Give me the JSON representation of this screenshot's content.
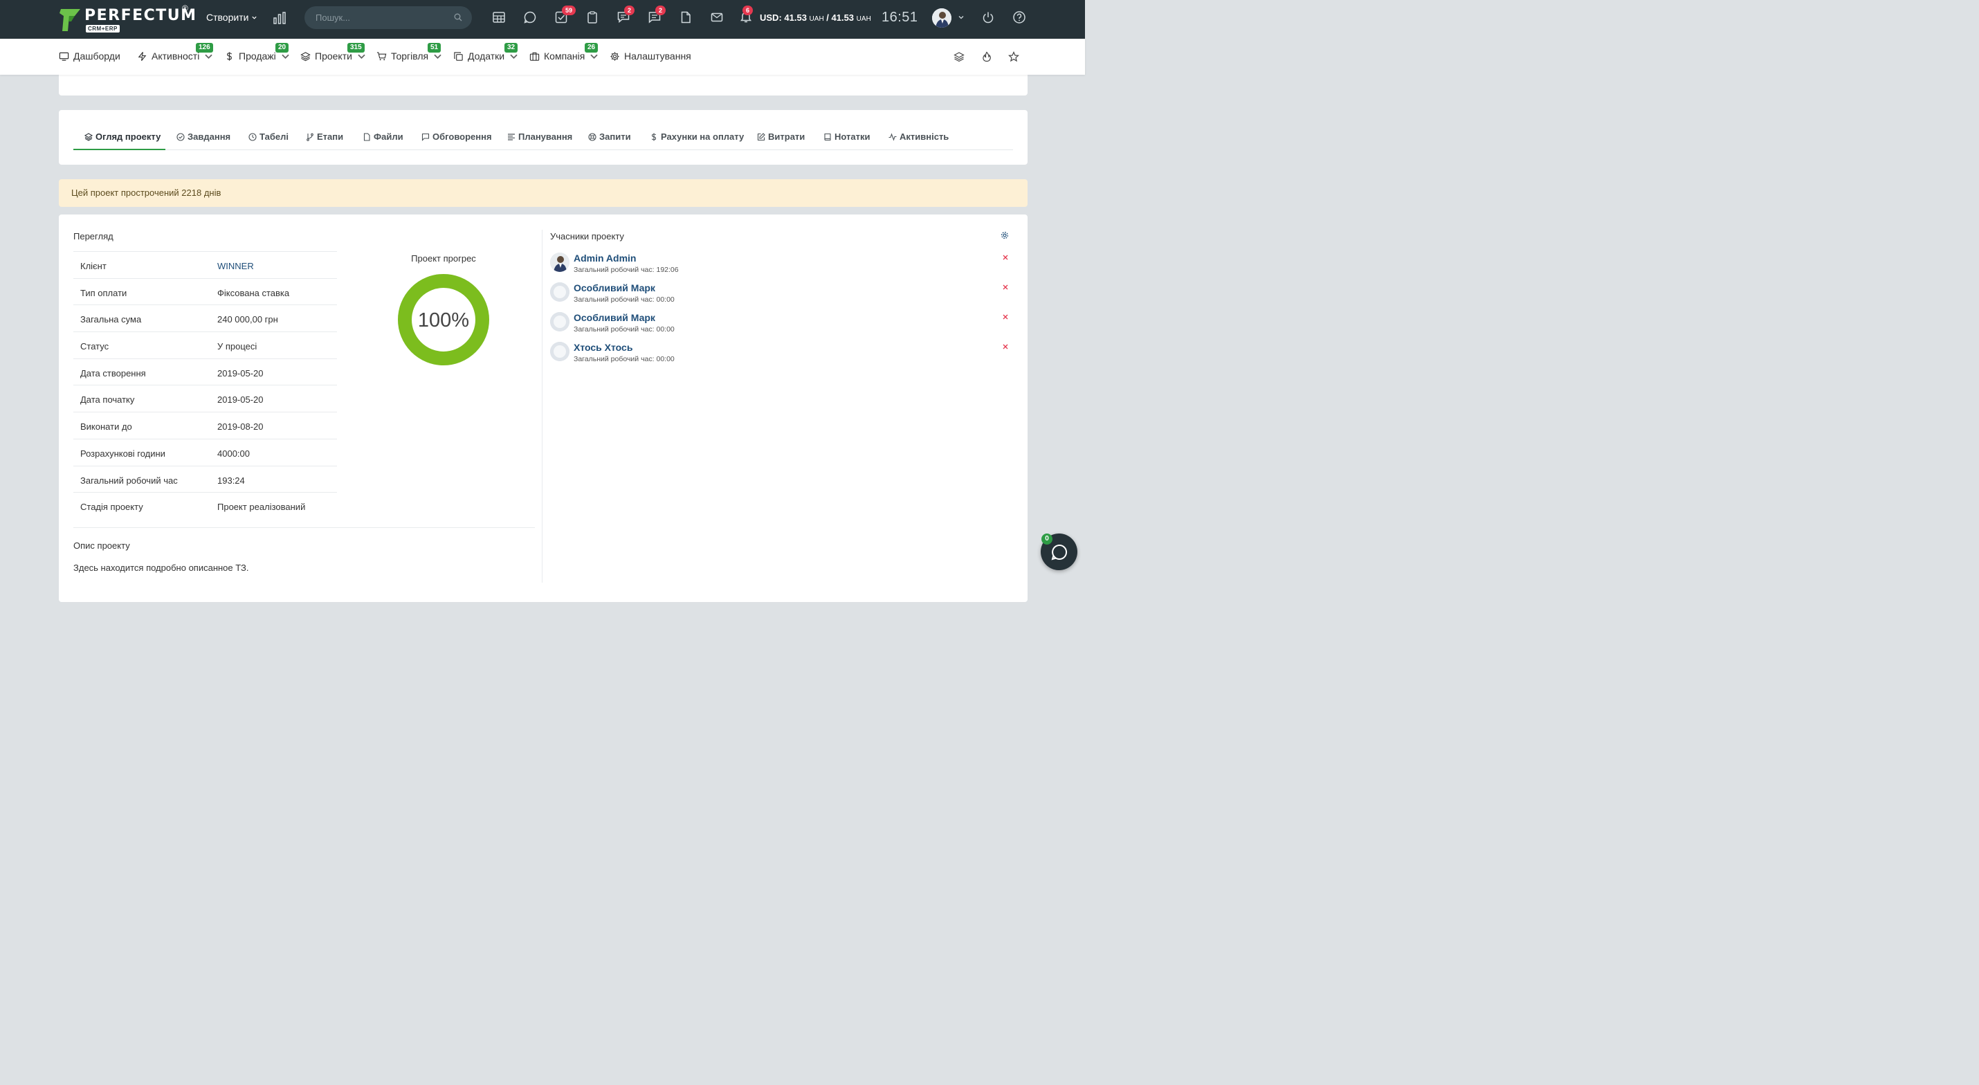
{
  "header": {
    "logo_text": "PERFECTUM",
    "logo_reg": "®",
    "logo_sub": "CRM+ERP",
    "create_label": "Створити",
    "search_placeholder": "Пошук...",
    "badges": {
      "tasks": "59",
      "chats": "2",
      "messages": "2",
      "notifications": "6"
    },
    "currency_label": "USD: 41.53",
    "currency_unit1": "UAH",
    "currency_sep": " / 41.53",
    "currency_unit2": "UAH",
    "clock": "16:51",
    "icons": [
      "chart-icon",
      "calendar-icon",
      "chat-icon",
      "tasks-icon",
      "clipboard-icon",
      "comments-icon",
      "message-icon",
      "file-icon",
      "mail-icon",
      "bell-icon",
      "power-icon",
      "help-icon"
    ]
  },
  "nav": {
    "items": [
      {
        "label": "Дашборди",
        "badge": ""
      },
      {
        "label": "Активності",
        "badge": "126"
      },
      {
        "label": "Продажі",
        "badge": "20"
      },
      {
        "label": "Проекти",
        "badge": "315"
      },
      {
        "label": "Торгівля",
        "badge": "51"
      },
      {
        "label": "Додатки",
        "badge": "32"
      },
      {
        "label": "Компанія",
        "badge": "26"
      },
      {
        "label": "Налаштування",
        "badge": ""
      }
    ]
  },
  "tabs": [
    {
      "label": "Огляд проекту",
      "icon": "layers-icon"
    },
    {
      "label": "Завдання",
      "icon": "check-circle-icon"
    },
    {
      "label": "Табелі",
      "icon": "clock-icon"
    },
    {
      "label": "Етапи",
      "icon": "git-branch-icon"
    },
    {
      "label": "Файли",
      "icon": "file-icon"
    },
    {
      "label": "Обговорення",
      "icon": "message-icon"
    },
    {
      "label": "Планування",
      "icon": "align-left-icon"
    },
    {
      "label": "Запити",
      "icon": "lifebuoy-icon"
    },
    {
      "label": "Рахунки на оплату",
      "icon": "dollar-icon"
    },
    {
      "label": "Витрати",
      "icon": "edit-icon"
    },
    {
      "label": "Нотатки",
      "icon": "book-icon"
    },
    {
      "label": "Активність",
      "icon": "activity-icon"
    }
  ],
  "alert": "Цей проект прострочений 2218 днів",
  "overview": {
    "title": "Перегляд",
    "rows": [
      {
        "key": "Клієнт",
        "value": "WINNER"
      },
      {
        "key": "Тип оплати",
        "value": "Фіксована ставка"
      },
      {
        "key": "Загальна сума",
        "value": "240 000,00 грн"
      },
      {
        "key": "Статус",
        "value": "У процесі"
      },
      {
        "key": "Дата створення",
        "value": "2019-05-20"
      },
      {
        "key": "Дата початку",
        "value": "2019-05-20"
      },
      {
        "key": "Виконати до",
        "value": "2019-08-20"
      },
      {
        "key": "Розрахункові години",
        "value": "4000:00"
      },
      {
        "key": "Загальний робочий час",
        "value": "193:24"
      },
      {
        "key": "Стадія проекту",
        "value": "Проект реалізований"
      }
    ]
  },
  "progress": {
    "title": "Проект прогрес",
    "value": 100,
    "label": "100%",
    "color": "#7cbd1e"
  },
  "description": {
    "title": "Опис проекту",
    "text": "Здесь находится подробно описанное ТЗ."
  },
  "members": {
    "title": "Учасники проекту",
    "list": [
      {
        "name": "Admin Admin",
        "sub": "Загальний робочий час: 192:06"
      },
      {
        "name": "Особливий Марк",
        "sub": "Загальний робочий час: 00:00"
      },
      {
        "name": "Особливий Марк",
        "sub": "Загальний робочий час: 00:00"
      },
      {
        "name": "Хтось Хтось",
        "sub": "Загальний робочий час: 00:00"
      }
    ]
  },
  "chat": {
    "badge": "0"
  }
}
